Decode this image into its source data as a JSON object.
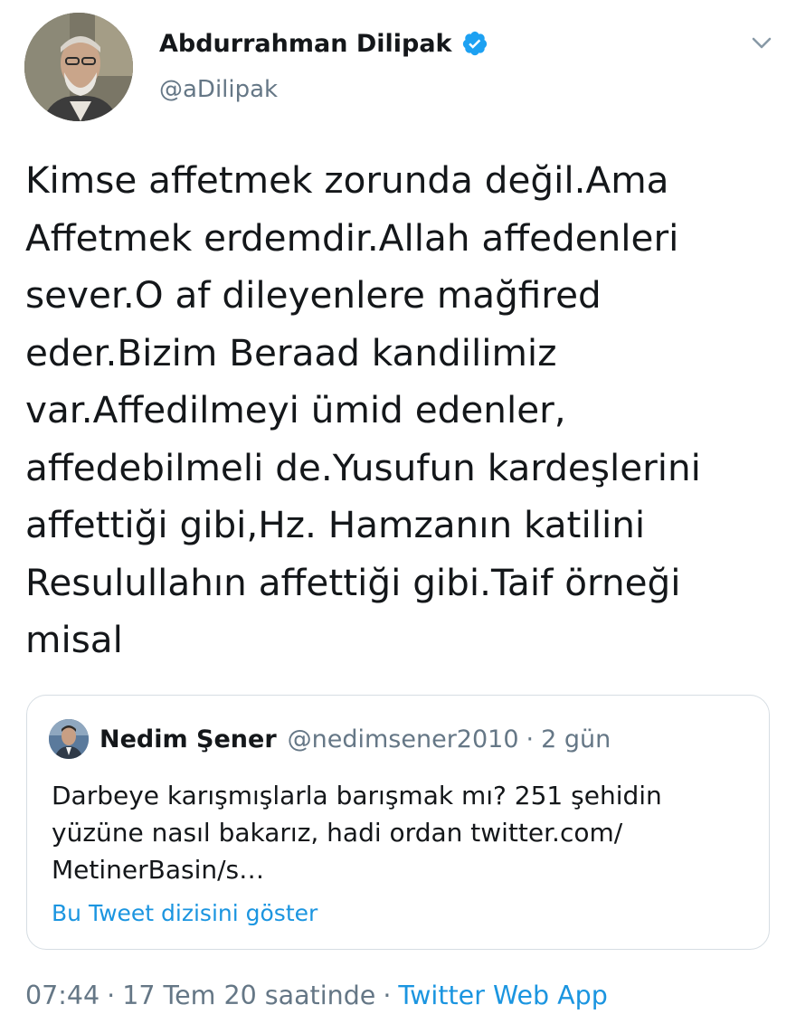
{
  "author": {
    "display_name": "Abdurrahman Dilipak",
    "handle": "@aDilipak",
    "verified_icon": "verified-badge-icon",
    "avatar_icon": "profile-photo"
  },
  "menu_icon": "chevron-down-icon",
  "tweet": {
    "text": "Kimse affetmek zorunda değil.Ama\nAffetmek erdemdir.Allah affedenleri\nsever.O af dileyenlere mağfired\neder.Bizim Beraad kandilimiz\nvar.Affedilmeyi ümid edenler,\naffedebilmeli de.Yusufun kardeşlerini\naffettiği gibi,Hz. Hamzanın katilini\nResulullahın affettiği gibi.Taif örneği\nmisal"
  },
  "quoted_tweet": {
    "display_name": "Nedim Şener",
    "handle": "@nedimsener2010",
    "separator": "·",
    "time": "2 gün",
    "text": "Darbeye karışmışlarla barışmak mı? 251 şehidin\nyüzüne nasıl bakarız, hadi ordan twitter.com/\nMetinerBasin/s…",
    "thread_link": "Bu Tweet dizisini göster"
  },
  "meta": {
    "time": "07:44",
    "separator": "·",
    "date": "17 Tem 20 saatinde",
    "source": "Twitter Web App"
  },
  "colors": {
    "accent": "#1b95e0",
    "verified": "#1da1f2",
    "secondary_text": "#657786",
    "primary_text": "#14171a",
    "border": "#d6dde3"
  }
}
